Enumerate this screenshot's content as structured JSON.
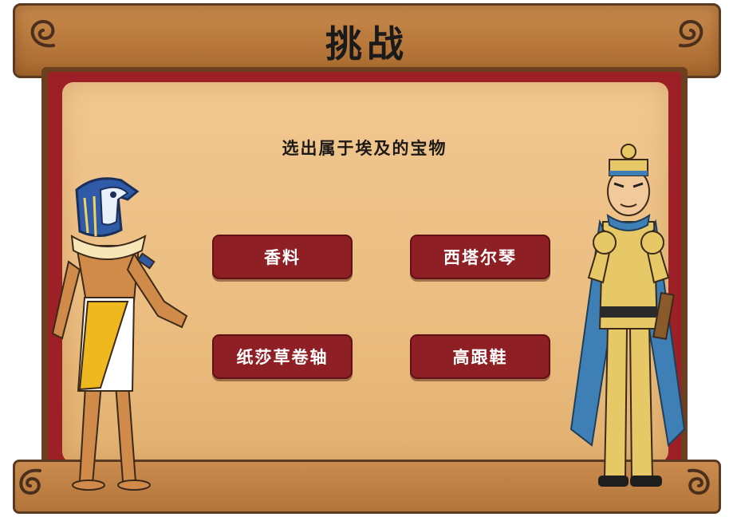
{
  "header": {
    "title": "挑战"
  },
  "question": {
    "text": "选出属于埃及的宝物"
  },
  "options": [
    {
      "label": "香料"
    },
    {
      "label": "西塔尔琴"
    },
    {
      "label": "纸莎草卷轴"
    },
    {
      "label": "高跟鞋"
    }
  ],
  "colors": {
    "wood": "#b8783c",
    "frame_red": "#9c2026",
    "paper": "#ebbd80",
    "button": "#8e1f24",
    "button_text": "#ffffff"
  },
  "icons": [
    "scroll-curl-icon",
    "horus-character",
    "explorer-character"
  ]
}
